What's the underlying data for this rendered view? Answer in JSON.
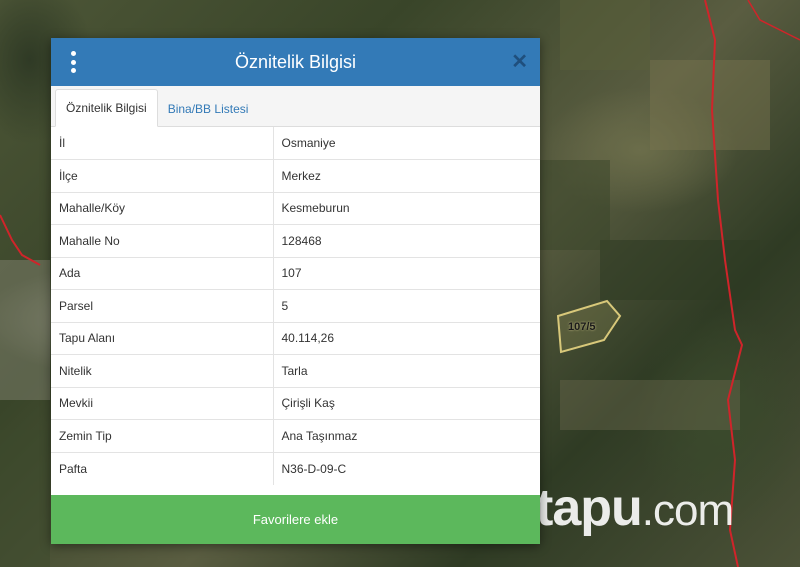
{
  "dialog": {
    "title": "Öznitelik Bilgisi",
    "menu_icon": "kebab-menu-icon",
    "close_icon": "close-icon",
    "close_glyph": "✕",
    "header_color": "#337ab7",
    "tabs": [
      {
        "label": "Öznitelik Bilgisi",
        "active": true
      },
      {
        "label": "Bina/BB Listesi",
        "active": false
      }
    ],
    "rows": [
      {
        "key": "İl",
        "value": "Osmaniye"
      },
      {
        "key": "İlçe",
        "value": "Merkez"
      },
      {
        "key": "Mahalle/Köy",
        "value": "Kesmeburun"
      },
      {
        "key": "Mahalle No",
        "value": "128468"
      },
      {
        "key": "Ada",
        "value": "107"
      },
      {
        "key": "Parsel",
        "value": "5"
      },
      {
        "key": "Tapu Alanı",
        "value": "40.114,26"
      },
      {
        "key": "Nitelik",
        "value": "Tarla"
      },
      {
        "key": "Mevkii",
        "value": "Çirişli Kaş"
      },
      {
        "key": "Zemin Tip",
        "value": "Ana Taşınmaz"
      },
      {
        "key": "Pafta",
        "value": "N36-D-09-C"
      }
    ],
    "favorite_button": "Favorilere ekle",
    "favorite_color": "#5cb85c"
  },
  "map": {
    "parcel_label": "107/5",
    "boundary_color": "#d0242a",
    "parcel_color": "#d8c87a"
  },
  "watermark": {
    "main": "tapu",
    "suffix": ".com"
  }
}
